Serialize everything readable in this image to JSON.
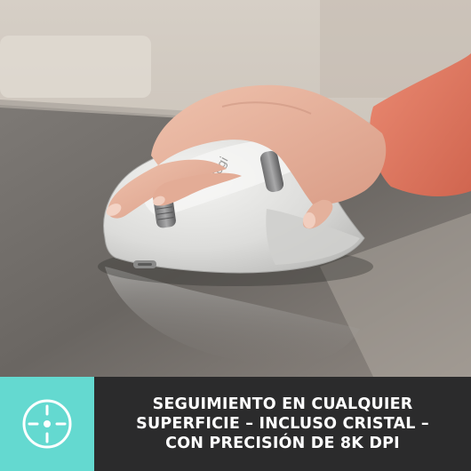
{
  "photo": {
    "subject": "hand-on-mouse",
    "mouse_brand_mark": "logi",
    "palette": {
      "wall": "#cfc8bf",
      "desk_glass": "#6e6a67",
      "mouse_body": "#e4e4e2",
      "skin": "#e8b7a2",
      "sleeve": "#e07a63"
    }
  },
  "banner": {
    "badge_icon": "tracking-crosshair-icon",
    "badge_color": "#64d9d0",
    "background": "#2b2b2c",
    "lines": [
      "SEGUIMIENTO EN CUALQUIER",
      "SUPERFICIE – INCLUSO CRISTAL –",
      "CON PRECISIÓN DE 8K DPI"
    ]
  }
}
